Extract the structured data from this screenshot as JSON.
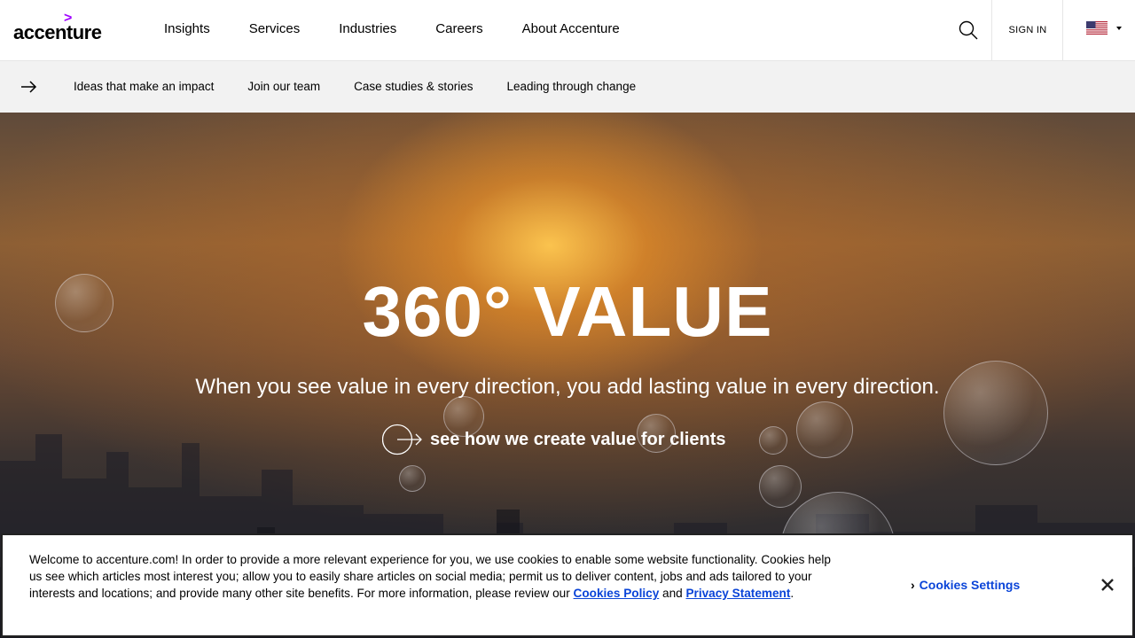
{
  "header": {
    "logo_text": "accenture",
    "logo_mark": ">",
    "nav": [
      "Insights",
      "Services",
      "Industries",
      "Careers",
      "About Accenture"
    ],
    "sign_in": "SIGN IN",
    "search_icon": "search-icon",
    "country_flag": "us-flag-icon"
  },
  "subnav": {
    "arrow_icon": "arrow-right-icon",
    "links": [
      "Ideas that make an impact",
      "Join our team",
      "Case studies & stories",
      "Leading through change"
    ]
  },
  "hero": {
    "title": "360° VALUE",
    "subtitle": "When you see value in every direction, you add lasting value in every direction.",
    "cta_label": "see how we create value for clients",
    "cta_icon": "circle-arrow-icon"
  },
  "cookie_banner": {
    "text": "Welcome to accenture.com! In order to provide a more relevant experience for you, we use cookies to enable some website functionality. Cookies help us see which articles most interest you; allow you to easily share articles on social media; permit us to deliver content, jobs and ads tailored to your interests and locations; and provide many other site benefits. For more information, please review our ",
    "cookies_policy_link": "Cookies Policy",
    "and": " and ",
    "privacy_link": "Privacy Statement",
    "period": ".",
    "settings_label": "Cookies Settings",
    "close_icon": "close-icon"
  },
  "colors": {
    "brand_purple": "#a100ff",
    "link_blue": "#0a44d8",
    "subnav_bg": "#f2f2f2"
  }
}
